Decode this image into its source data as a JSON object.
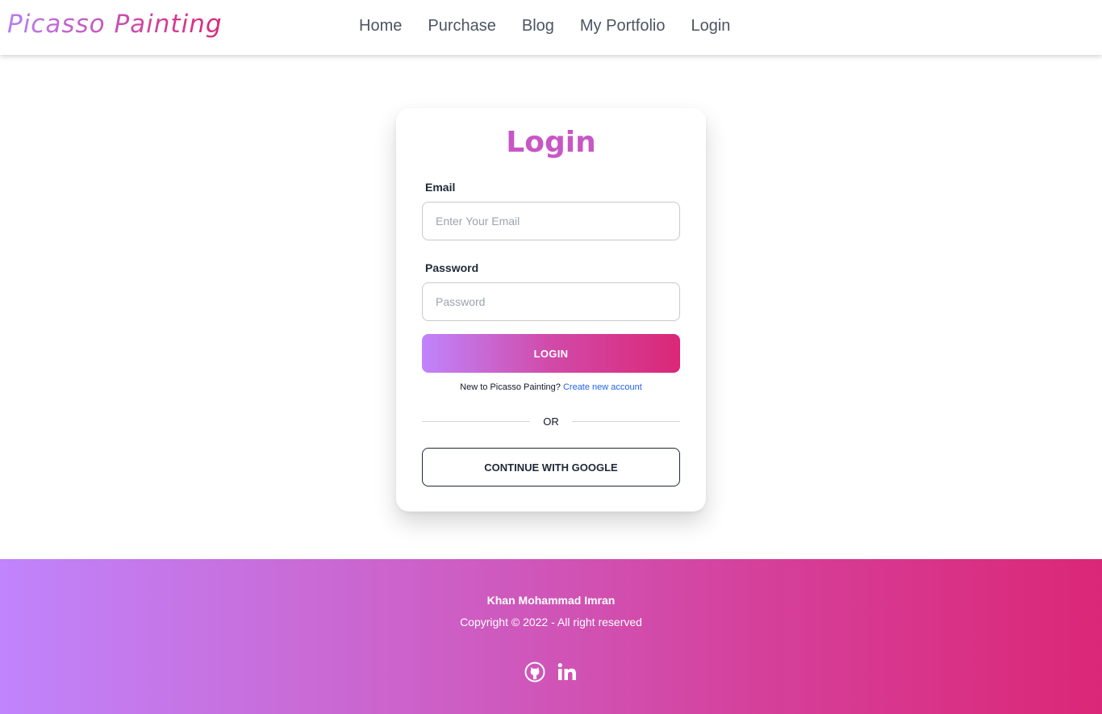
{
  "header": {
    "brand": "Picasso Painting",
    "nav": [
      {
        "label": "Home"
      },
      {
        "label": "Purchase"
      },
      {
        "label": "Blog"
      },
      {
        "label": "My Portfolio"
      },
      {
        "label": "Login"
      }
    ]
  },
  "login": {
    "title": "Login",
    "email": {
      "label": "Email",
      "placeholder": "Enter Your Email",
      "value": ""
    },
    "password": {
      "label": "Password",
      "placeholder": "Password",
      "value": ""
    },
    "submit_label": "LOGIN",
    "signup_prompt": "New to Picasso Painting?",
    "signup_link": "Create new account",
    "divider_text": "OR",
    "google_label": "CONTINUE WITH GOOGLE"
  },
  "footer": {
    "name": "Khan Mohammad Imran",
    "copyright": "Copyright © 2022 - All right reserved",
    "socials": [
      {
        "icon": "github-icon"
      },
      {
        "icon": "linkedin-icon"
      }
    ]
  },
  "colors": {
    "accent_start": "#c084fc",
    "accent_end": "#db2777",
    "link": "#2563eb"
  }
}
